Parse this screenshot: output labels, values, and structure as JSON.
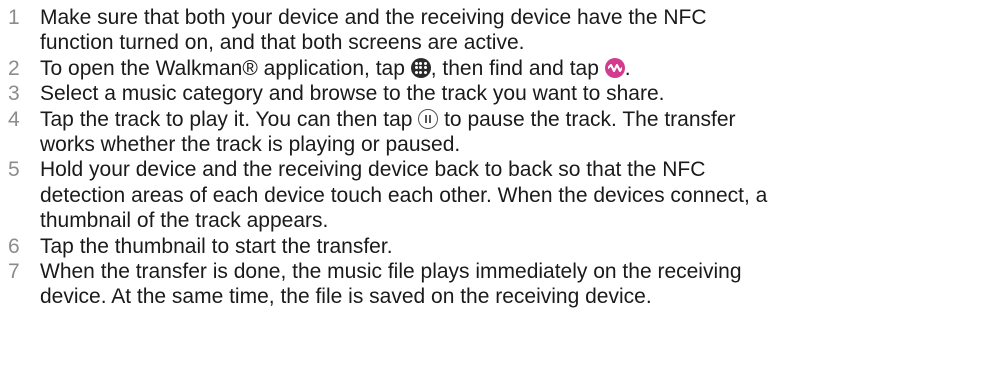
{
  "steps": [
    {
      "number": "1",
      "lines": [
        "Make sure that both your device and the receiving device have the NFC",
        "function turned on, and that both screens are active."
      ]
    },
    {
      "number": "2",
      "part1": "To open the Walkman® application, tap ",
      "part2": ", then find and tap ",
      "part3": "."
    },
    {
      "number": "3",
      "lines": [
        "Select a music category and browse to the track you want to share."
      ]
    },
    {
      "number": "4",
      "part1": "Tap the track to play it. You can then tap ",
      "part2": " to pause the track. The transfer",
      "line2": "works whether the track is playing or paused."
    },
    {
      "number": "5",
      "lines": [
        "Hold your device and the receiving device back to back so that the NFC",
        "detection areas of each device touch each other. When the devices connect, a",
        "thumbnail of the track appears."
      ]
    },
    {
      "number": "6",
      "lines": [
        "Tap the thumbnail to start the transfer."
      ]
    },
    {
      "number": "7",
      "lines": [
        "When the transfer is done, the music file plays immediately on the receiving",
        "device. At the same time, the file is saved on the receiving device."
      ]
    }
  ],
  "icons": {
    "apps": "apps-grid-icon",
    "walkman": "walkman-icon",
    "pause": "pause-icon"
  },
  "colors": {
    "step_number": "#8c8c8c",
    "text": "#1a1a1a",
    "walkman_icon": "#d23b8e",
    "apps_icon": "#2b2b2b"
  }
}
